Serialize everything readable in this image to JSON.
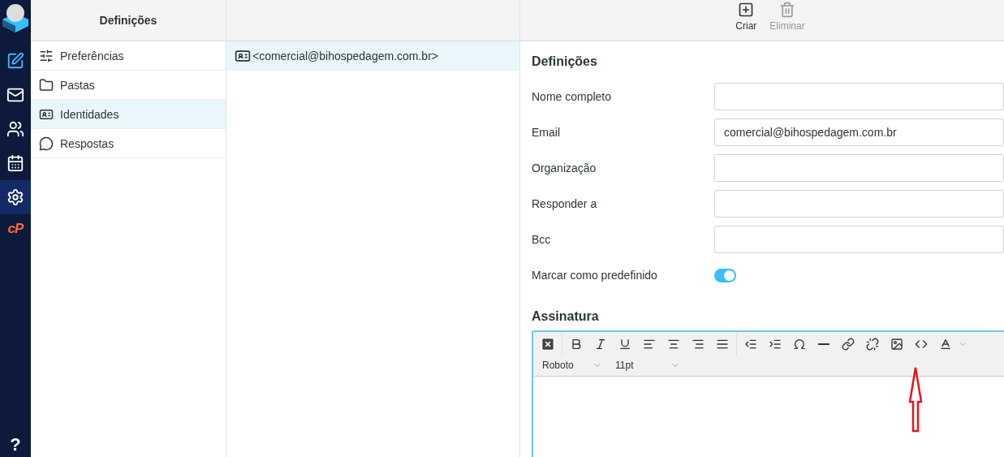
{
  "rail": {
    "items": [
      {
        "kind": "compose",
        "selected": false
      },
      {
        "kind": "mail",
        "selected": false
      },
      {
        "kind": "contacts",
        "selected": false
      },
      {
        "kind": "calendar",
        "selected": false
      },
      {
        "kind": "settings",
        "selected": true
      }
    ],
    "cpanel": "cP",
    "help": "?"
  },
  "sections": {
    "title": "Definições",
    "items": [
      {
        "kind": "preferences",
        "label": "Preferências",
        "selected": false
      },
      {
        "kind": "folders",
        "label": "Pastas",
        "selected": false
      },
      {
        "kind": "identities",
        "label": "Identidades",
        "selected": true
      },
      {
        "kind": "responses",
        "label": "Respostas",
        "selected": false
      }
    ]
  },
  "identities": [
    {
      "label": "<comercial@bihospedagem.com.br>",
      "selected": true
    }
  ],
  "toolbar": [
    {
      "kind": "create",
      "label": "Criar",
      "disabled": false
    },
    {
      "kind": "delete",
      "label": "Eliminar",
      "disabled": true
    }
  ],
  "form": {
    "title": "Definições",
    "fields": [
      {
        "kind": "text",
        "label": "Nome completo"
      },
      {
        "kind": "text",
        "label": "Email",
        "value": "comercial@bihospedagem.com.br"
      },
      {
        "kind": "text",
        "label": "Organização"
      },
      {
        "kind": "text",
        "label": "Responder a"
      },
      {
        "kind": "text",
        "label": "Bcc"
      },
      {
        "kind": "toggle",
        "label": "Marcar como predefinido",
        "on": true
      }
    ]
  },
  "signature": {
    "title": "Assinatura",
    "buttons": [
      {
        "kind": "clear"
      },
      {
        "kind": "bold"
      },
      {
        "kind": "italic"
      },
      {
        "kind": "underline"
      },
      {
        "kind": "align-left"
      },
      {
        "kind": "align-center"
      },
      {
        "kind": "align-right"
      },
      {
        "kind": "align-justify"
      },
      {
        "kind": "outdent"
      },
      {
        "kind": "indent"
      },
      {
        "kind": "omega"
      },
      {
        "kind": "rule"
      },
      {
        "kind": "link"
      },
      {
        "kind": "unlink"
      },
      {
        "kind": "image"
      },
      {
        "kind": "code"
      },
      {
        "kind": "text-color"
      }
    ],
    "font": "Roboto",
    "size": "11pt"
  }
}
